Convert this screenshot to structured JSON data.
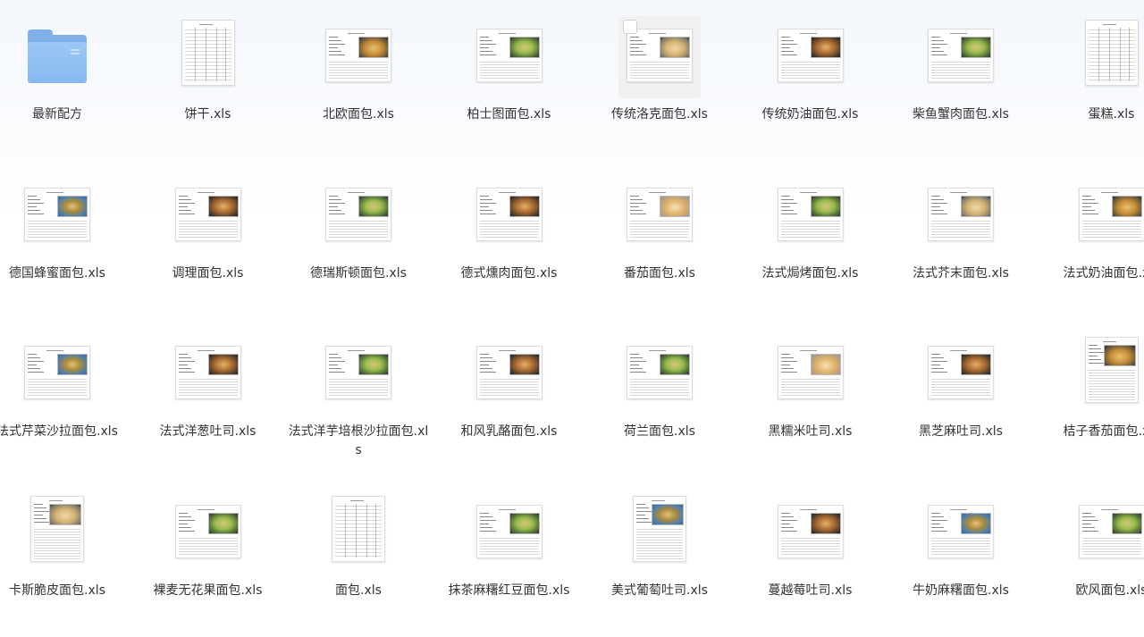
{
  "items": [
    {
      "label": "最新配方",
      "kind": "folder",
      "icon": "folder-icon"
    },
    {
      "label": "饼干.xls",
      "kind": "table",
      "icon": "spreadsheet-icon"
    },
    {
      "label": "北欧面包.xls",
      "kind": "sheet",
      "photo": "p-bread",
      "icon": "spreadsheet-icon"
    },
    {
      "label": "柏士图面包.xls",
      "kind": "sheet",
      "photo": "p-green",
      "icon": "spreadsheet-icon"
    },
    {
      "label": "传统洛克面包.xls",
      "kind": "sheet",
      "photo": "p-pale",
      "icon": "spreadsheet-icon",
      "selected": true
    },
    {
      "label": "传统奶油面包.xls",
      "kind": "sheet",
      "photo": "p-dark",
      "icon": "spreadsheet-icon"
    },
    {
      "label": "柴鱼蟹肉面包.xls",
      "kind": "sheet",
      "photo": "p-green",
      "icon": "spreadsheet-icon"
    },
    {
      "label": "蛋糕.xls",
      "kind": "table",
      "icon": "spreadsheet-icon"
    },
    {
      "label": "德国蜂蜜面包.xls",
      "kind": "sheet",
      "photo": "p-blue",
      "icon": "spreadsheet-icon"
    },
    {
      "label": "调理面包.xls",
      "kind": "sheet",
      "photo": "p-dark",
      "icon": "spreadsheet-icon"
    },
    {
      "label": "德瑞斯顿面包.xls",
      "kind": "sheet",
      "photo": "p-green",
      "icon": "spreadsheet-icon"
    },
    {
      "label": "德式燻肉面包.xls",
      "kind": "sheet",
      "photo": "p-dark",
      "icon": "spreadsheet-icon"
    },
    {
      "label": "番茄面包.xls",
      "kind": "sheet",
      "photo": "p-light",
      "icon": "spreadsheet-icon"
    },
    {
      "label": "法式焗烤面包.xls",
      "kind": "sheet",
      "photo": "p-green",
      "icon": "spreadsheet-icon"
    },
    {
      "label": "法式芥末面包.xls",
      "kind": "sheet",
      "photo": "p-pale",
      "icon": "spreadsheet-icon"
    },
    {
      "label": "法式奶油面包.xls",
      "kind": "sheet",
      "photo": "p-bread",
      "icon": "spreadsheet-icon"
    },
    {
      "label": "法式芹菜沙拉面包.xls",
      "kind": "sheet",
      "photo": "p-blue",
      "icon": "spreadsheet-icon"
    },
    {
      "label": "法式洋葱吐司.xls",
      "kind": "sheet",
      "photo": "p-dark",
      "icon": "spreadsheet-icon"
    },
    {
      "label": "法式洋芋培根沙拉面包.xls",
      "kind": "sheet",
      "photo": "p-green",
      "icon": "spreadsheet-icon"
    },
    {
      "label": "和风乳酪面包.xls",
      "kind": "sheet",
      "photo": "p-dark",
      "icon": "spreadsheet-icon"
    },
    {
      "label": "荷兰面包.xls",
      "kind": "sheet",
      "photo": "p-green",
      "icon": "spreadsheet-icon"
    },
    {
      "label": "黑糯米吐司.xls",
      "kind": "sheet",
      "photo": "p-light",
      "icon": "spreadsheet-icon"
    },
    {
      "label": "黑芝麻吐司.xls",
      "kind": "sheet",
      "photo": "p-dark",
      "icon": "spreadsheet-icon"
    },
    {
      "label": "桔子香茄面包.xls",
      "kind": "sheet",
      "photo": "p-bread",
      "icon": "spreadsheet-icon",
      "tall": true
    },
    {
      "label": "卡斯脆皮面包.xls",
      "kind": "sheet",
      "photo": "p-pale",
      "icon": "spreadsheet-icon",
      "tall": true
    },
    {
      "label": "裸麦无花果面包.xls",
      "kind": "sheet",
      "photo": "p-green",
      "icon": "spreadsheet-icon"
    },
    {
      "label": "面包.xls",
      "kind": "table",
      "icon": "spreadsheet-icon"
    },
    {
      "label": "抹茶麻糬红豆面包.xls",
      "kind": "sheet",
      "photo": "p-green",
      "icon": "spreadsheet-icon"
    },
    {
      "label": "美式葡萄吐司.xls",
      "kind": "sheet",
      "photo": "p-blue",
      "icon": "spreadsheet-icon",
      "tall": true
    },
    {
      "label": "蔓越莓吐司.xls",
      "kind": "sheet",
      "photo": "p-dark",
      "icon": "spreadsheet-icon"
    },
    {
      "label": "牛奶麻糬面包.xls",
      "kind": "sheet",
      "photo": "p-blue",
      "icon": "spreadsheet-icon"
    },
    {
      "label": "欧风面包.xls",
      "kind": "sheet",
      "photo": "p-green",
      "icon": "spreadsheet-icon"
    }
  ],
  "colors": {
    "folder": "#86b8f0",
    "label_text": "#333333",
    "selection_bg": "#f1f1f1"
  }
}
